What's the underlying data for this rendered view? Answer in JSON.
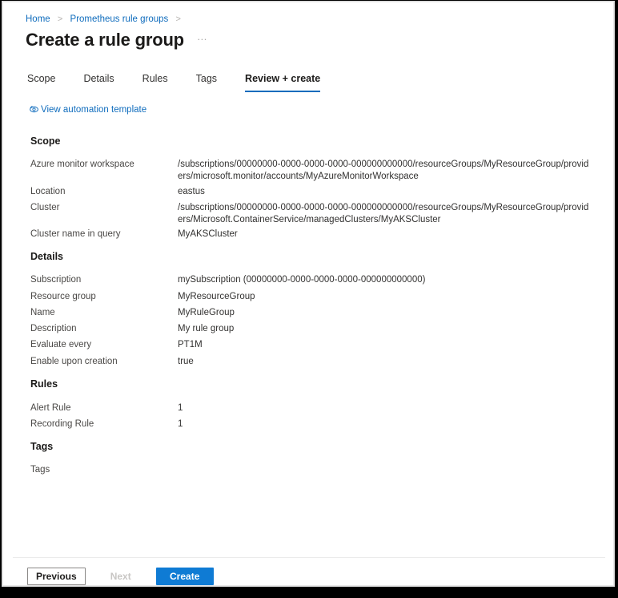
{
  "breadcrumb": {
    "items": [
      {
        "label": "Home"
      },
      {
        "label": "Prometheus rule groups"
      }
    ],
    "separator": ">"
  },
  "header": {
    "title": "Create a rule group",
    "more_label": "…"
  },
  "tabs": [
    {
      "label": "Scope",
      "active": false
    },
    {
      "label": "Details",
      "active": false
    },
    {
      "label": "Rules",
      "active": false
    },
    {
      "label": "Tags",
      "active": false
    },
    {
      "label": "Review + create",
      "active": true
    }
  ],
  "automation_link": {
    "label": "View automation template",
    "icon": "view-eye-icon",
    "color": "#0f6cbd"
  },
  "sections": {
    "scope": {
      "heading": "Scope",
      "rows": [
        {
          "label": "Azure monitor workspace",
          "value": "/subscriptions/00000000-0000-0000-0000-000000000000/resourceGroups/MyResourceGroup/providers/microsoft.monitor/accounts/MyAzureMonitorWorkspace"
        },
        {
          "label": "Location",
          "value": "eastus"
        },
        {
          "label": "Cluster",
          "value": "/subscriptions/00000000-0000-0000-0000-000000000000/resourceGroups/MyResourceGroup/providers/Microsoft.ContainerService/managedClusters/MyAKSCluster"
        },
        {
          "label": "Cluster name in query",
          "value": "MyAKSCluster"
        }
      ]
    },
    "details": {
      "heading": "Details",
      "rows": [
        {
          "label": "Subscription",
          "value": "mySubscription (00000000-0000-0000-0000-000000000000)"
        },
        {
          "label": "Resource group",
          "value": "MyResourceGroup"
        },
        {
          "label": "Name",
          "value": "MyRuleGroup"
        },
        {
          "label": "Description",
          "value": "My rule group"
        },
        {
          "label": "Evaluate every",
          "value": "PT1M"
        },
        {
          "label": "Enable upon creation",
          "value": "true"
        }
      ]
    },
    "rules": {
      "heading": "Rules",
      "rows": [
        {
          "label": "Alert Rule",
          "value": "1"
        },
        {
          "label": "Recording Rule",
          "value": "1"
        }
      ]
    },
    "tags": {
      "heading": "Tags",
      "rows": [
        {
          "label": "Tags",
          "value": ""
        }
      ]
    }
  },
  "footer": {
    "previous_label": "Previous",
    "next_label": "Next",
    "create_label": "Create"
  },
  "colors": {
    "accent": "#0f6cbd",
    "primary_button": "#0f7bd4",
    "text": "#323130"
  }
}
